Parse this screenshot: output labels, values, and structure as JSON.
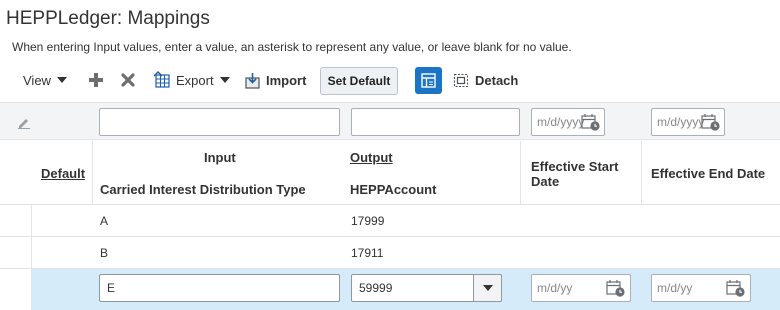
{
  "page": {
    "title": "HEPPLedger: Mappings",
    "instructions": "When entering Input values, enter a value, an asterisk to represent any value, or leave blank for no value."
  },
  "toolbar": {
    "view_label": "View",
    "export_label": "Export",
    "import_label": "Import",
    "set_default_label": "Set Default",
    "detach_label": "Detach"
  },
  "filters": {
    "input_value": "",
    "output_value": "",
    "start_date_placeholder": "m/d/yyyy",
    "end_date_placeholder": "m/d/yyyy"
  },
  "columns": {
    "default_label": "Default",
    "input_group": "Input",
    "input_sub": "Carried Interest Distribution Type",
    "output_group": "Output",
    "output_sub": "HEPPAccount",
    "start_line1": "Effective Start",
    "start_line2": "Date",
    "end_label": "Effective End Date"
  },
  "rows": [
    {
      "input": "A",
      "output": "17999"
    },
    {
      "input": "B",
      "output": "17911"
    }
  ],
  "edit_row": {
    "input": "E",
    "output": "59999",
    "start_placeholder": "m/d/yy",
    "end_placeholder": "m/d/yy"
  },
  "colors": {
    "accent": "#1b74c5",
    "selected_row": "#d6ebfa"
  }
}
